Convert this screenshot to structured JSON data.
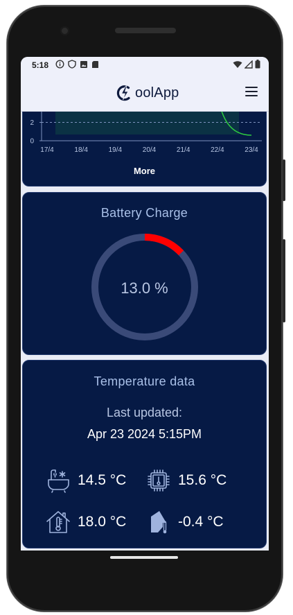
{
  "status_bar": {
    "time": "5:18",
    "icons": [
      "info-icon",
      "shield-icon",
      "image-icon",
      "sim-icon"
    ],
    "right_icons": [
      "wifi-icon",
      "signal-icon",
      "battery-icon"
    ]
  },
  "app_bar": {
    "title": "oolApp",
    "logo_icon": "lightning-c-logo",
    "menu_icon": "hamburger-icon"
  },
  "history_card": {
    "chart_data": {
      "type": "line",
      "title": "",
      "xlabel": "",
      "ylabel": "",
      "ylim": [
        0,
        4
      ],
      "yticks": [
        "0",
        "2",
        "4"
      ],
      "categories": [
        "17/4",
        "18/4",
        "19/4",
        "20/4",
        "21/4",
        "22/4",
        "23/4"
      ],
      "threshold": 2,
      "series": [
        {
          "values": [
            null,
            null,
            null,
            null,
            null,
            4,
            0.6
          ],
          "color": "#2ecc40"
        }
      ]
    },
    "more_label": "More"
  },
  "battery_card": {
    "title": "Battery Charge",
    "value_text": "13.0 %",
    "percent": 13.0,
    "colors": {
      "fill": "#ff0000",
      "track": "#3a4a78"
    }
  },
  "temperature_card": {
    "title": "Temperature data",
    "last_updated_label": "Last updated:",
    "last_updated_value": "Apr 23 2024 5:15PM",
    "readings": [
      {
        "icon": "water-tank-snowflake-icon",
        "value": "14.5 °C"
      },
      {
        "icon": "chip-thermometer-icon",
        "value": "15.6 °C"
      },
      {
        "icon": "house-thermometer-icon",
        "value": "18.0 °C"
      },
      {
        "icon": "outdoor-thermometer-icon",
        "value": "-0.4 °C"
      }
    ]
  },
  "colors": {
    "card_bg": "#061a45",
    "accent": "#a9c0e8",
    "app_bar_bg": "#eef0fa"
  }
}
